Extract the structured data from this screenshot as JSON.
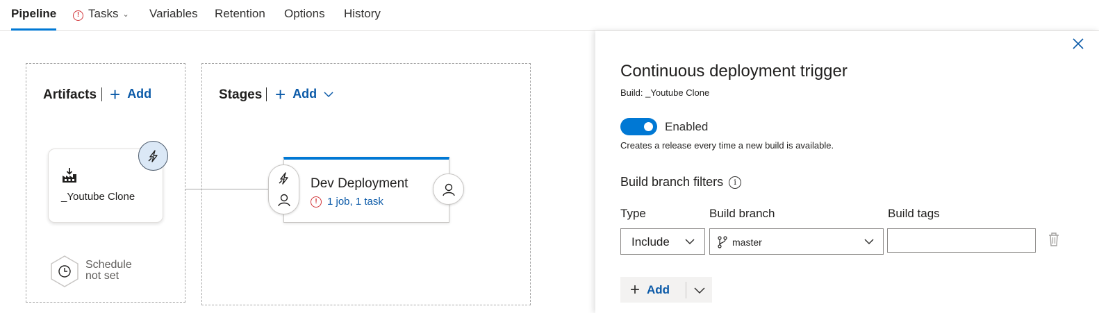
{
  "nav": {
    "tabs": [
      {
        "label": "Pipeline",
        "active": true
      },
      {
        "label": "Tasks",
        "icon": "warning-icon",
        "has_dropdown": true
      },
      {
        "label": "Variables"
      },
      {
        "label": "Retention"
      },
      {
        "label": "Options"
      },
      {
        "label": "History"
      }
    ]
  },
  "artifacts": {
    "title": "Artifacts",
    "add_label": "Add",
    "card": {
      "name": "_Youtube Clone",
      "icon": "build-factory-icon",
      "trigger_icon": "lightning-icon"
    },
    "schedule": {
      "line1": "Schedule",
      "line2": "not set",
      "icon": "clock-icon"
    }
  },
  "stages": {
    "title": "Stages",
    "add_label": "Add",
    "stage": {
      "name": "Dev Deployment",
      "status": "1 job, 1 task",
      "status_icon": "error-icon"
    }
  },
  "panel": {
    "title": "Continuous deployment trigger",
    "subtitle": "Build: _Youtube Clone",
    "toggle": {
      "label": "Enabled",
      "on": true
    },
    "description": "Creates a release every time a new build is available.",
    "filters_title": "Build branch filters",
    "columns": {
      "type": "Type",
      "branch": "Build branch",
      "tags": "Build tags"
    },
    "row": {
      "type": "Include",
      "branch": "master",
      "tags": ""
    },
    "add_label": "Add"
  },
  "colors": {
    "accent": "#0078d4",
    "link": "#0b5aa8",
    "error": "#d13438"
  }
}
